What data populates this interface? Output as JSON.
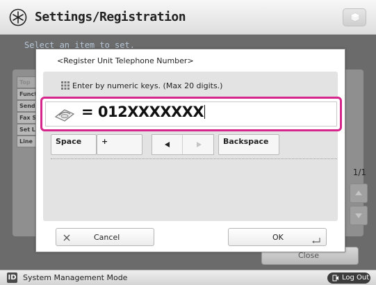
{
  "header": {
    "title": "Settings/Registration",
    "app_icon": "settings-snowflake-icon",
    "top_button_icon": "home-cube-icon"
  },
  "background": {
    "message": "Select an item to set.",
    "tabs": [
      "Top",
      "Funct",
      "Send",
      "Fax S",
      "Set L",
      "Line"
    ],
    "page_indicator": "1/1",
    "close_label": "Close"
  },
  "dialog": {
    "title": "<Register Unit Telephone Number>",
    "hint": "Enter by numeric keys. (Max 20 digits.)",
    "entry_value": "= 012XXXXXXX",
    "entry_icon": "telephone-icon",
    "keys": {
      "space": "Space",
      "plus": "+",
      "left_arrow": "◀",
      "right_arrow": "▶",
      "backspace": "Backspace"
    },
    "cancel_label": "Cancel",
    "ok_label": "OK"
  },
  "status": {
    "mode_icon_label": "ID",
    "mode_text": "System Management Mode",
    "logout_label": "Log Out"
  },
  "colors": {
    "highlight": "#d6258a"
  }
}
